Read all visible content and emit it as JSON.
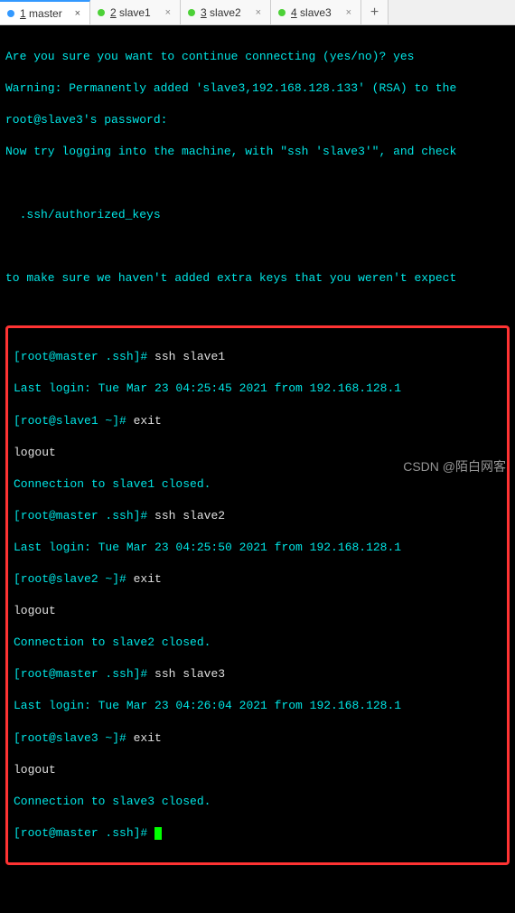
{
  "tabs": [
    {
      "num": "1",
      "name": "master",
      "dot": "blue",
      "active": true
    },
    {
      "num": "2",
      "name": "slave1",
      "dot": "green",
      "active": false
    },
    {
      "num": "3",
      "name": "slave2",
      "dot": "green",
      "active": false
    },
    {
      "num": "4",
      "name": "slave3",
      "dot": "green",
      "active": false
    }
  ],
  "tab_close": "×",
  "tab_plus": "+",
  "preamble": {
    "l1": "Are you sure you want to continue connecting (yes/no)? yes",
    "l2": "Warning: Permanently added 'slave3,192.168.128.133' (RSA) to the",
    "l3": "root@slave3's password:",
    "l4": "Now try logging into the machine, with \"ssh 'slave3'\", and check",
    "l5": "",
    "l6": "  .ssh/authorized_keys",
    "l7": "",
    "l8": "to make sure we haven't added extra keys that you weren't expect"
  },
  "box": {
    "l1a": "[root@master .ssh]# ",
    "l1b": "ssh slave1",
    "l2": "Last login: Tue Mar 23 04:25:45 2021 from 192.168.128.1",
    "l3a": "[root@slave1 ~]# ",
    "l3b": "exit",
    "l4": "logout",
    "l5": "Connection to slave1 closed.",
    "l6a": "[root@master .ssh]# ",
    "l6b": "ssh slave2",
    "l7": "Last login: Tue Mar 23 04:25:50 2021 from 192.168.128.1",
    "l8a": "[root@slave2 ~]# ",
    "l8b": "exit",
    "l9": "logout",
    "l10": "Connection to slave2 closed.",
    "l11a": "[root@master .ssh]# ",
    "l11b": "ssh slave3",
    "l12": "Last login: Tue Mar 23 04:26:04 2021 from 192.168.128.1",
    "l13a": "[root@slave3 ~]# ",
    "l13b": "exit",
    "l14": "logout",
    "l15": "Connection to slave3 closed.",
    "l16": "[root@master .ssh]# "
  },
  "watermark": "CSDN @陌白网客"
}
